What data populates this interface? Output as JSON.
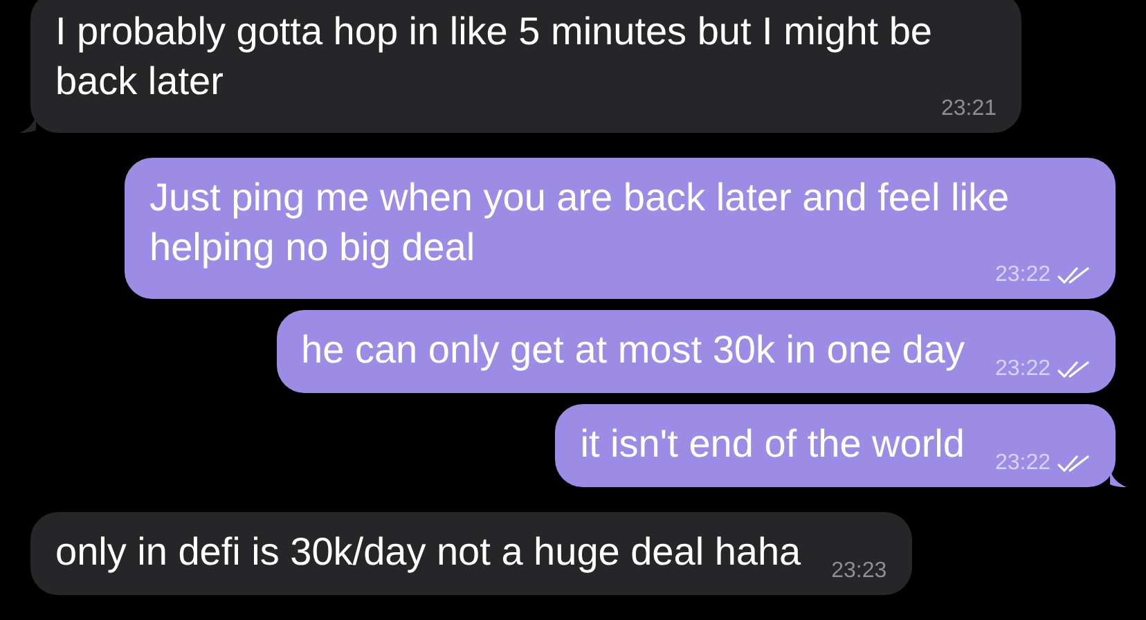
{
  "messages": [
    {
      "kind": "incoming",
      "text": "I probably gotta hop in like 5 minutes but I might be back later",
      "time": "23:21",
      "tail": true
    },
    {
      "kind": "outgoing",
      "text": "Just ping me when you are back later and feel like helping no big deal",
      "time": "23:22",
      "tail": false,
      "read": true
    },
    {
      "kind": "outgoing",
      "text": "he can only get at most 30k in one day",
      "time": "23:22",
      "tail": false,
      "read": true
    },
    {
      "kind": "outgoing",
      "text": "it isn't end of the world",
      "time": "23:22",
      "tail": true,
      "read": true
    },
    {
      "kind": "incoming",
      "text": "only in defi is 30k/day not a huge deal haha",
      "time": "23:23",
      "tail": false
    }
  ]
}
